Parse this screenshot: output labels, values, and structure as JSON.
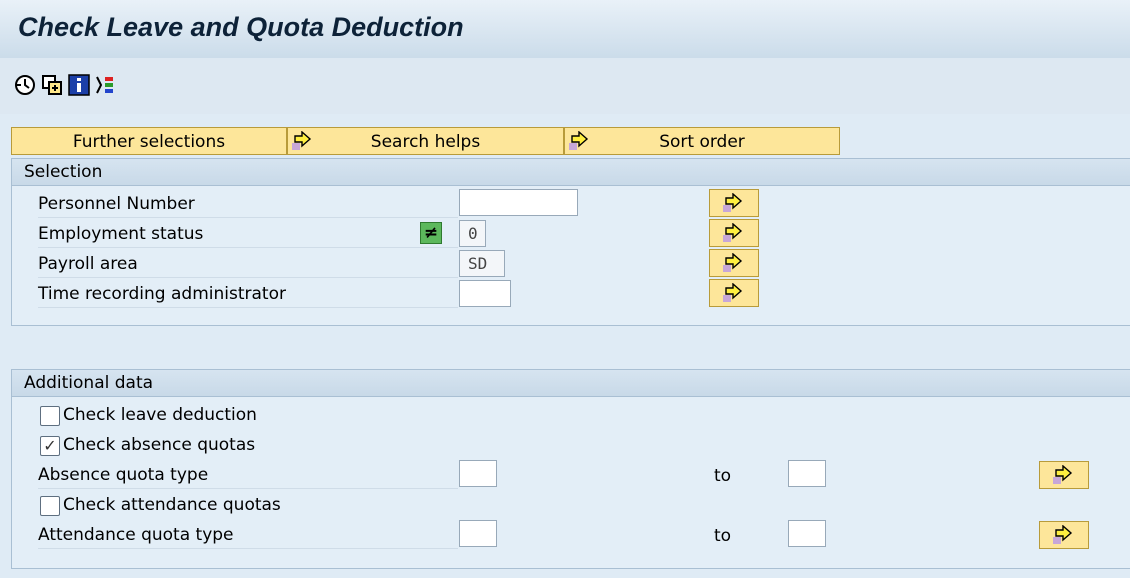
{
  "title": "Check Leave and Quota Deduction",
  "toolbar": {
    "icons": [
      "execute-icon",
      "get-variant-icon",
      "info-icon",
      "selection-options-icon"
    ]
  },
  "tabs": {
    "further": "Further selections",
    "search": "Search helps",
    "sort": "Sort order"
  },
  "selection": {
    "header": "Selection",
    "personnel_number": {
      "label": "Personnel Number",
      "value": ""
    },
    "employment_status": {
      "label": "Employment status",
      "value": "0"
    },
    "payroll_area": {
      "label": "Payroll area",
      "value": "SD"
    },
    "time_admin": {
      "label": "Time recording administrator",
      "value": ""
    }
  },
  "additional": {
    "header": "Additional data",
    "check_leave": {
      "label": "Check leave deduction",
      "checked": false
    },
    "check_absence": {
      "label": "Check absence quotas",
      "checked": true,
      "mark": "✓"
    },
    "absence_type": {
      "label": "Absence quota type",
      "to": "to"
    },
    "check_attendance": {
      "label": "Check attendance quotas",
      "checked": false
    },
    "attendance_type": {
      "label": "Attendance quota type",
      "to": "to"
    }
  },
  "colors": {
    "accent_yellow": "#fde69a",
    "background": "#dfebf5",
    "neq_green": "#5cb85c"
  }
}
